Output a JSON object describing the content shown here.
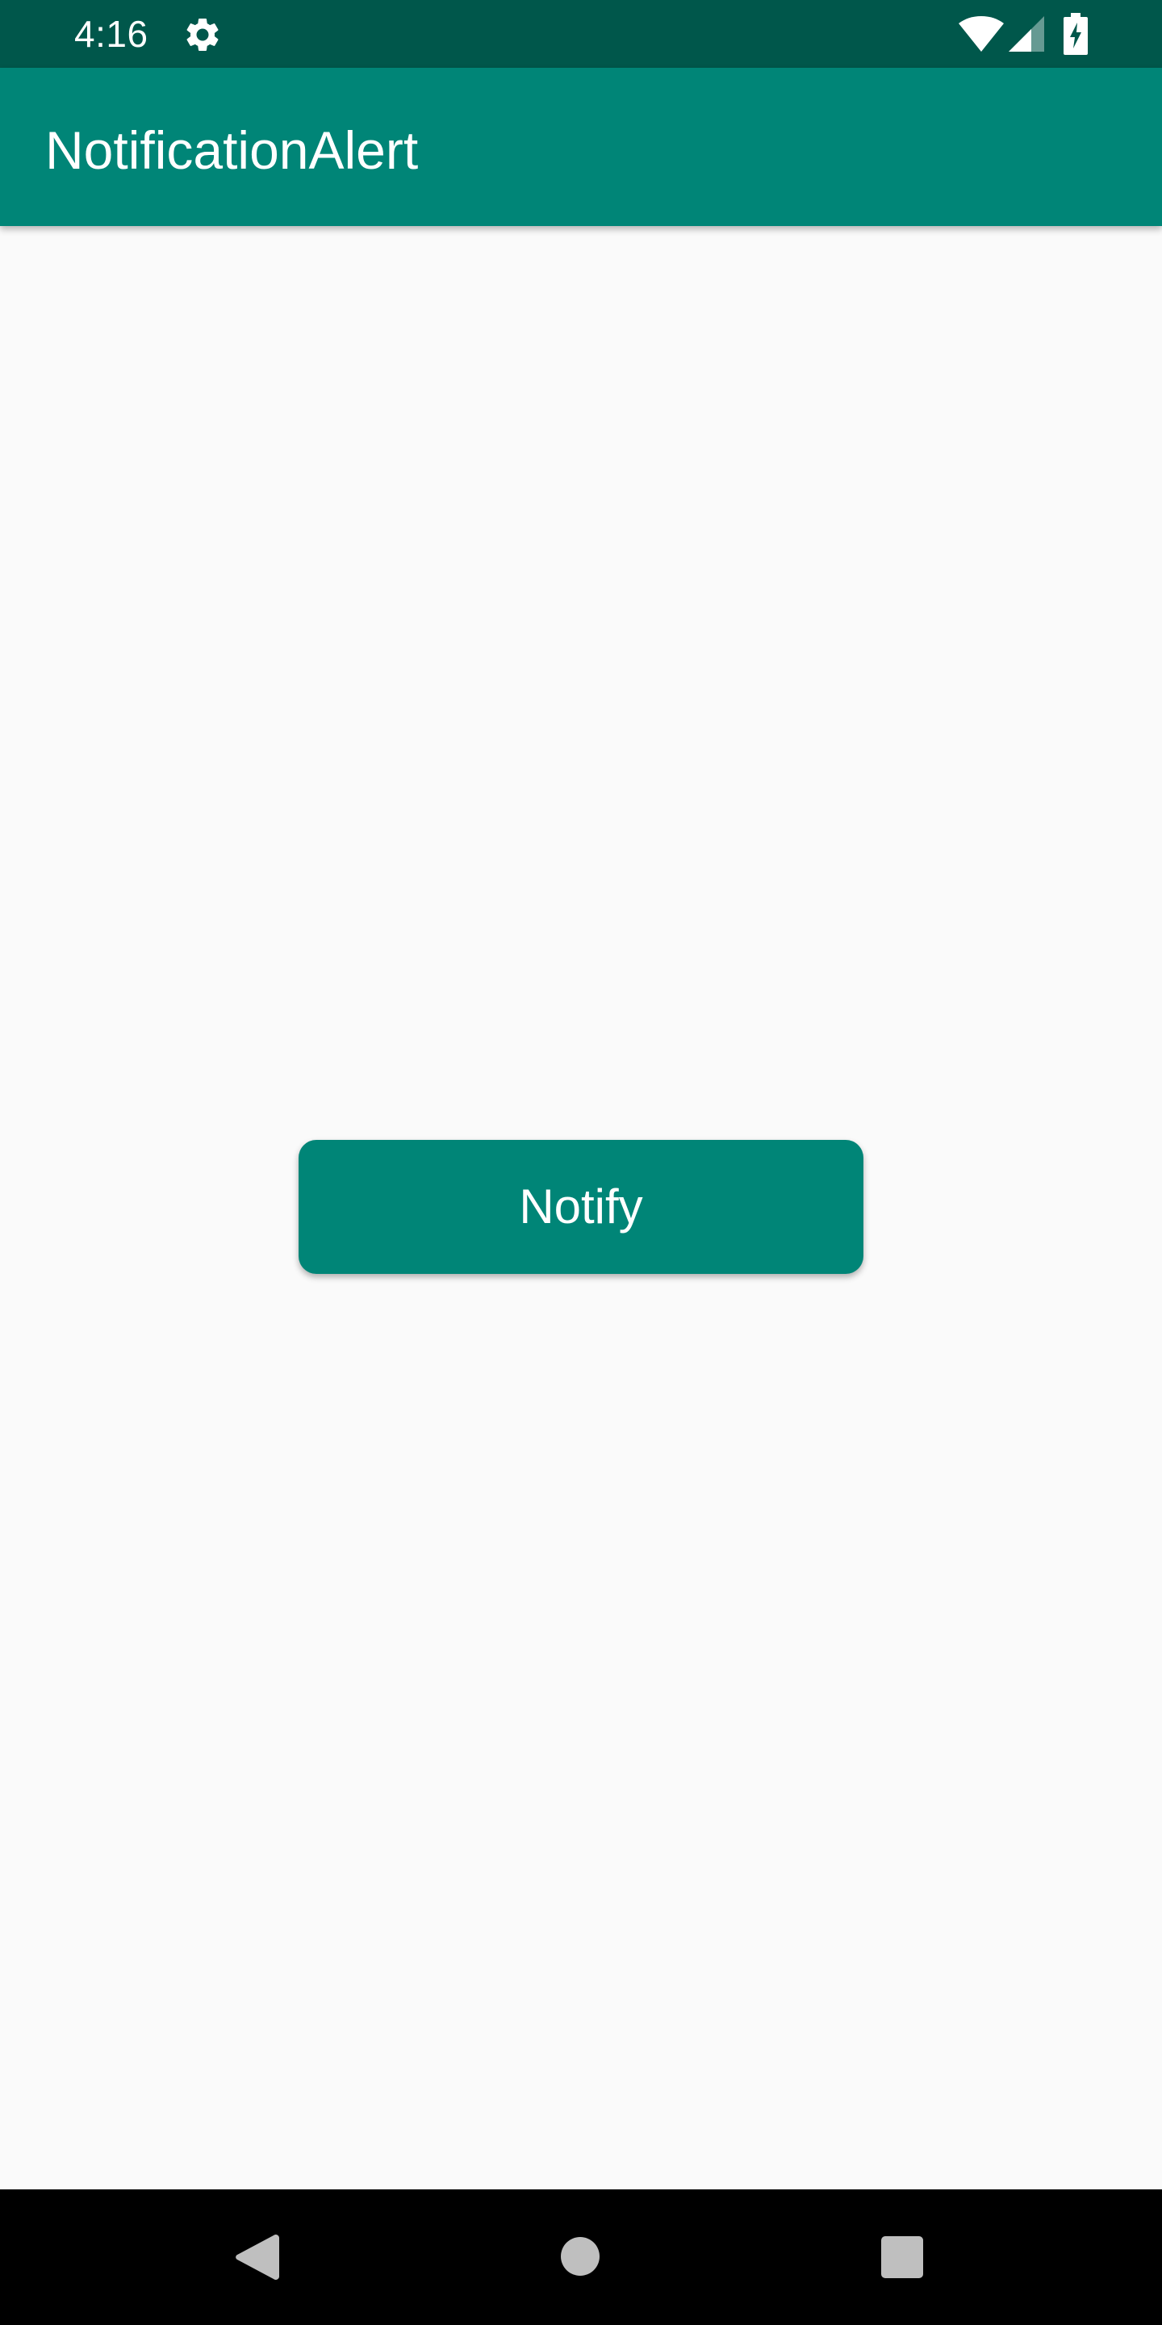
{
  "status_bar": {
    "time": "4:16",
    "icons": [
      "gear-icon",
      "wifi-icon",
      "signal-icon",
      "battery-charging-icon"
    ]
  },
  "app_bar": {
    "title": "NotificationAlert"
  },
  "main": {
    "notify_button_label": "Notify"
  },
  "nav_bar": {
    "icons": [
      "back-icon",
      "home-icon",
      "recents-icon"
    ]
  },
  "colors": {
    "status_bar": "#00574b",
    "primary": "#008577",
    "background": "#fafafa",
    "nav_bar": "#000000",
    "on_primary": "#ffffff"
  }
}
